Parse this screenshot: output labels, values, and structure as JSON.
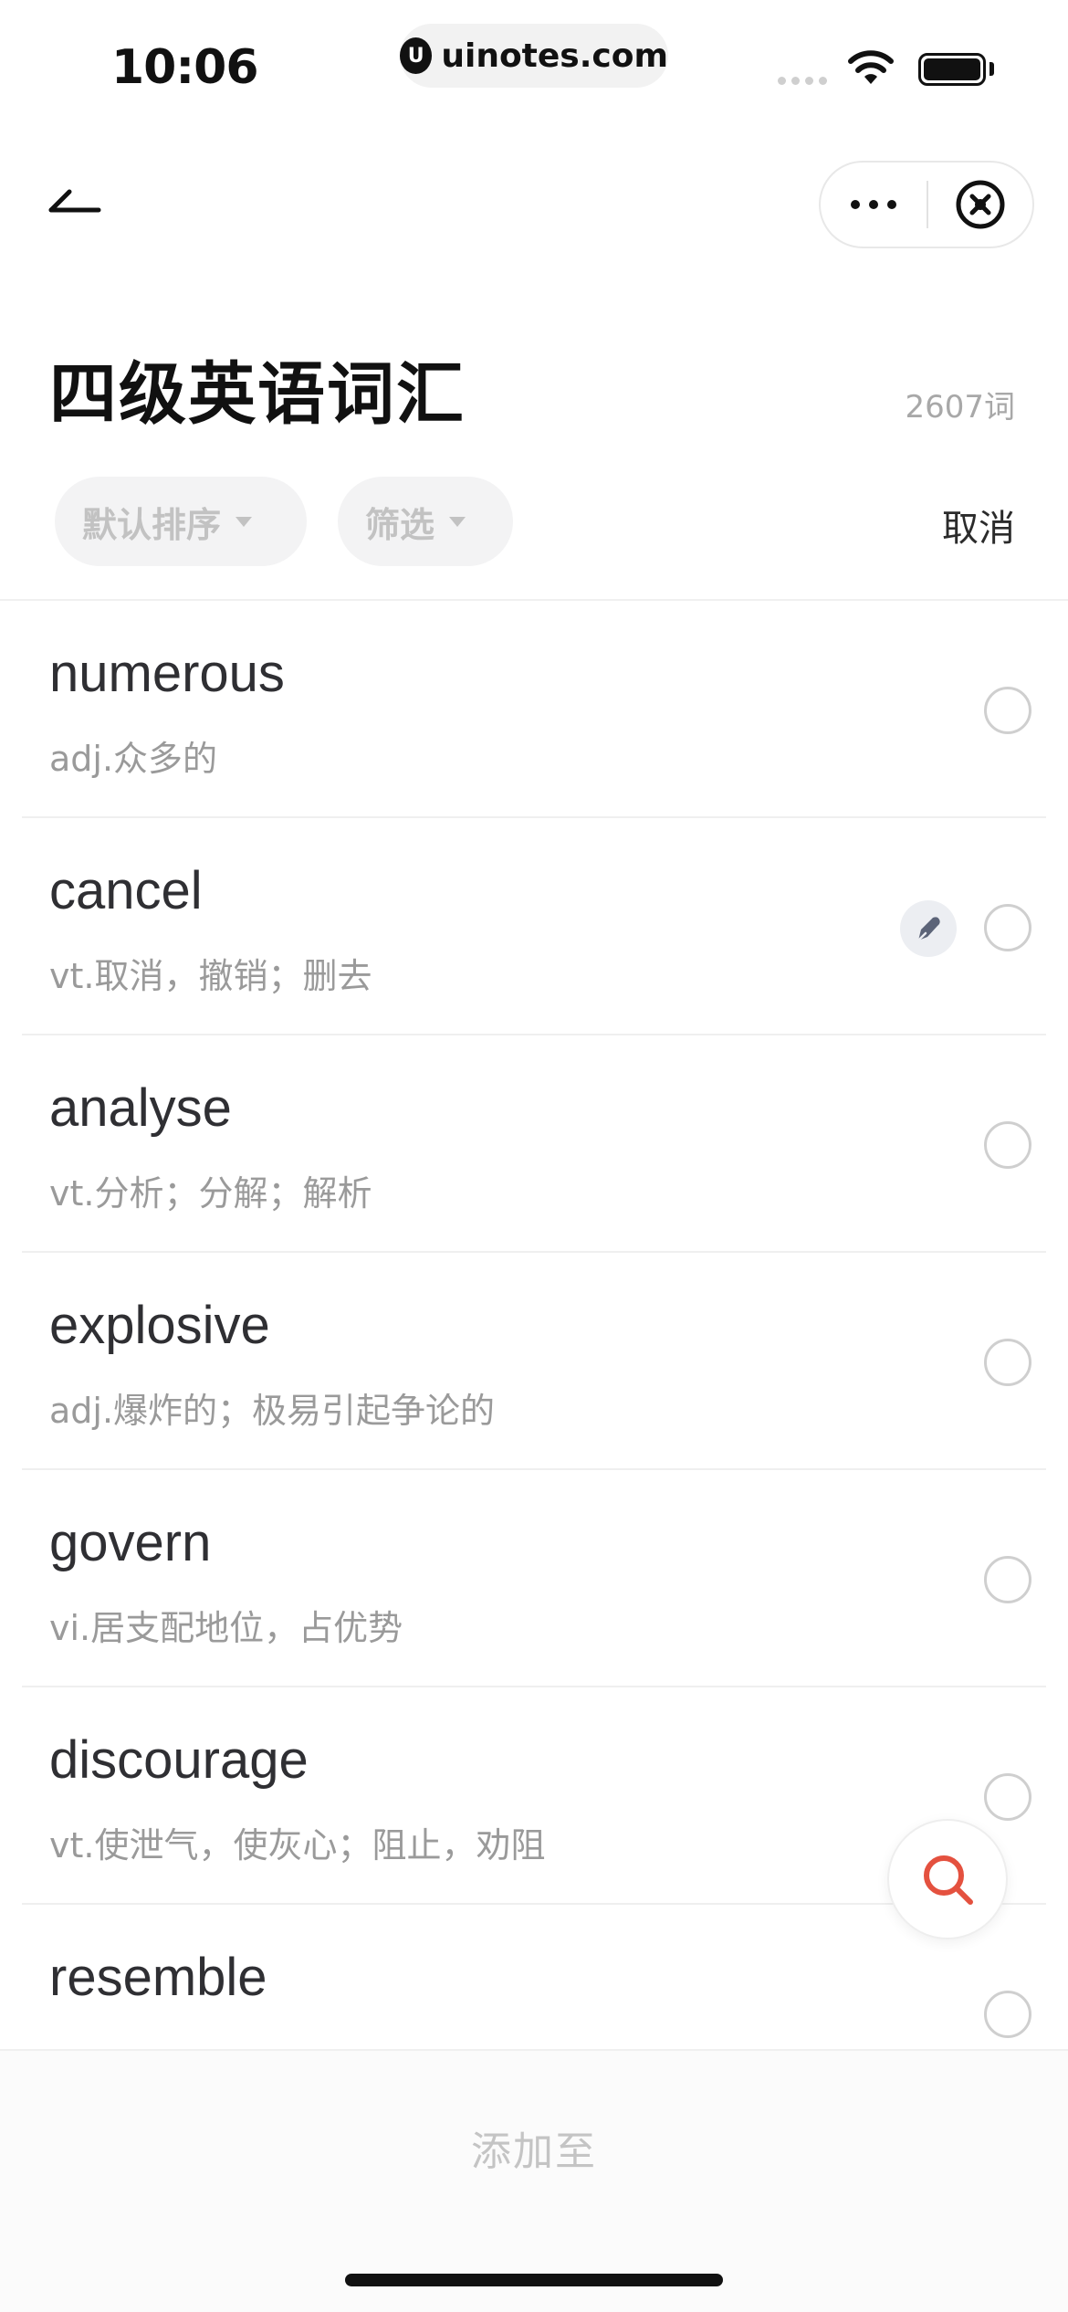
{
  "status": {
    "time": "10:06",
    "url": "uinotes.com"
  },
  "header": {
    "title": "四级英语词汇",
    "count": "2607词"
  },
  "toolbar": {
    "sort_label": "默认排序",
    "filter_label": "筛选",
    "cancel_label": "取消"
  },
  "words": [
    {
      "word": "numerous",
      "meaning": "adj.众多的",
      "has_note": false
    },
    {
      "word": "cancel",
      "meaning": "vt.取消，撤销；删去",
      "has_note": true
    },
    {
      "word": "analyse",
      "meaning": "vt.分析；分解；解析",
      "has_note": false
    },
    {
      "word": "explosive",
      "meaning": "adj.爆炸的；极易引起争论的",
      "has_note": false
    },
    {
      "word": "govern",
      "meaning": "vi.居支配地位，占优势",
      "has_note": false
    },
    {
      "word": "discourage",
      "meaning": "vt.使泄气，使灰心；阻止，劝阻",
      "has_note": false
    },
    {
      "word": "resemble",
      "meaning": "",
      "has_note": false
    }
  ],
  "footer": {
    "add_to_label": "添加至"
  },
  "colors": {
    "accent": "#e4513f",
    "divider": "#efefef",
    "muted_text": "#9a9a9a"
  }
}
